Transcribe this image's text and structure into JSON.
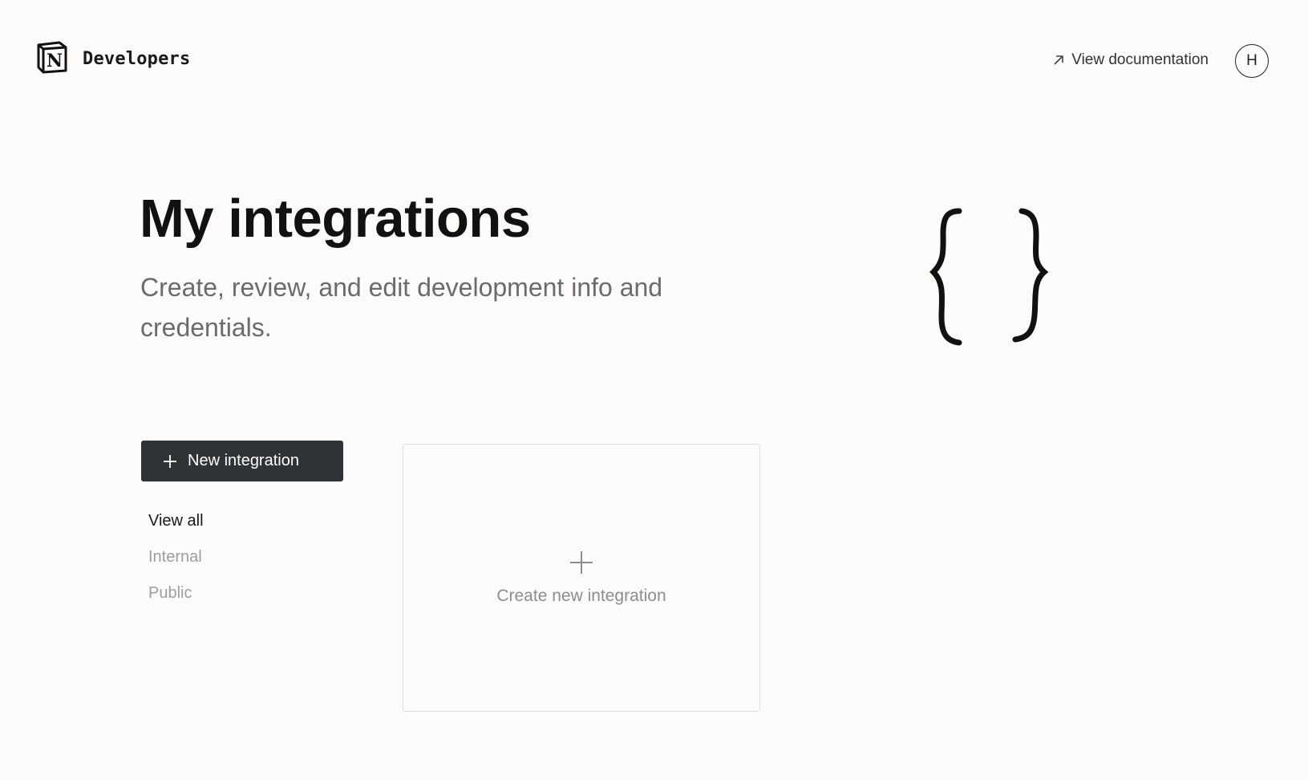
{
  "header": {
    "brand": "Developers",
    "doc_link": "View documentation",
    "avatar_initial": "H"
  },
  "hero": {
    "title": "My integrations",
    "subtitle": "Create, review, and edit development info and credentials."
  },
  "actions": {
    "new_integration": "New integration"
  },
  "filters": [
    {
      "label": "View all",
      "active": true
    },
    {
      "label": "Internal",
      "active": false
    },
    {
      "label": "Public",
      "active": false
    }
  ],
  "card": {
    "create_label": "Create new integration"
  },
  "icons": {
    "logo": "notion-logo-icon",
    "doc": "arrow-up-right-icon",
    "braces": "curly-braces-icon",
    "plus": "plus-icon"
  },
  "colors": {
    "background": "#fcfbfa",
    "button": "#2f3336",
    "muted_text": "#a09e9b"
  }
}
